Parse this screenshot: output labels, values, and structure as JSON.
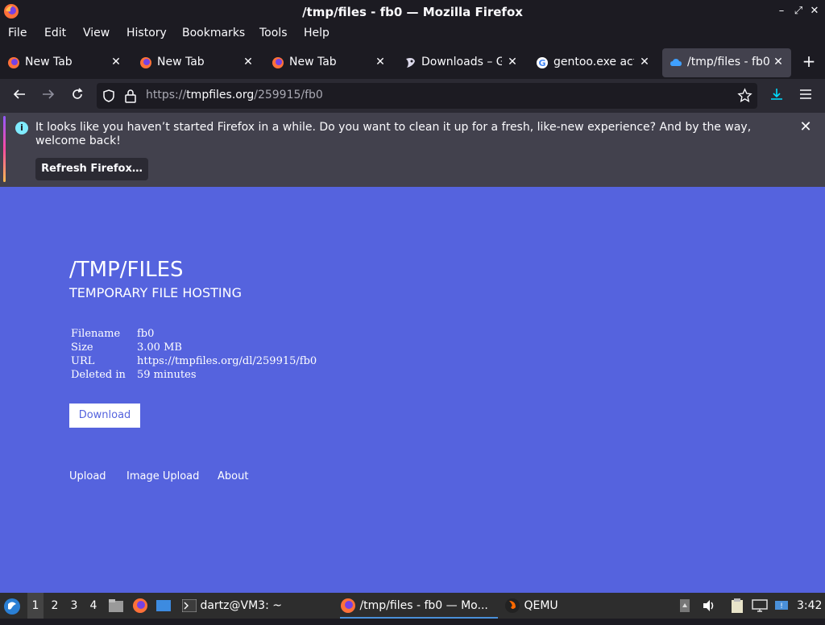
{
  "window": {
    "title": "/tmp/files - fb0 — Mozilla Firefox"
  },
  "menubar": {
    "items": [
      "File",
      "Edit",
      "View",
      "History",
      "Bookmarks",
      "Tools",
      "Help"
    ]
  },
  "tabs": [
    {
      "label": "New Tab",
      "icon": "firefox-icon"
    },
    {
      "label": "New Tab",
      "icon": "firefox-icon"
    },
    {
      "label": "New Tab",
      "icon": "firefox-icon"
    },
    {
      "label": "Downloads – Ge",
      "icon": "gentoo-icon"
    },
    {
      "label": "gentoo.exe acti",
      "icon": "google-icon"
    },
    {
      "label": "/tmp/files - fb0",
      "icon": "cloud-icon",
      "active": true
    }
  ],
  "navbar": {
    "url_prefix": "https://",
    "url_host": "tmpfiles.org",
    "url_path": "/259915/fb0"
  },
  "notification": {
    "message": "It looks like you haven’t started Firefox in a while. Do you want to clean it up for a fresh, like-new experience? And by the way, welcome back!",
    "button_label": "Refresh Firefox…"
  },
  "page": {
    "title": "/TMP/FILES",
    "subtitle": "TEMPORARY FILE HOSTING",
    "rows": [
      {
        "key": "Filename",
        "value": "fb0"
      },
      {
        "key": "Size",
        "value": "3.00 MB"
      },
      {
        "key": "URL",
        "value": "https://tmpfiles.org/dl/259915/fb0"
      },
      {
        "key": "Deleted in",
        "value": "59 minutes"
      }
    ],
    "download_label": "Download",
    "footer_links": [
      "Upload",
      "Image Upload",
      "About"
    ],
    "background_color": "#5563de"
  },
  "taskbar": {
    "workspaces": [
      "1",
      "2",
      "3",
      "4"
    ],
    "terminal_task": "dartz@VM3: ~",
    "firefox_task": "/tmp/files - fb0 — Mo...",
    "qemu_task": "QEMU",
    "clock": "3:42"
  }
}
